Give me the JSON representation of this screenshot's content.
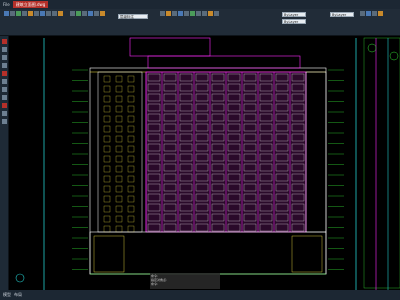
{
  "app": {
    "title": "建筑立面图.dwg"
  },
  "menu": {
    "file": "File"
  },
  "ribbon": {
    "layer_combo": "层级标注",
    "color_combo": "ByLayer",
    "linetype_combo": "ByLayer",
    "lineweight_combo": "ByLayer"
  },
  "commandline": {
    "lines": [
      "命令: ",
      "指定对角点:",
      "命令:"
    ]
  },
  "status": {
    "model": "模型",
    "layout": "布局"
  },
  "colors": {
    "bg": "#000000",
    "magenta": "#ff2bff",
    "yellow": "#ffee44",
    "green": "#33dd33",
    "cyan": "#22cccc",
    "white": "#ffffff"
  }
}
